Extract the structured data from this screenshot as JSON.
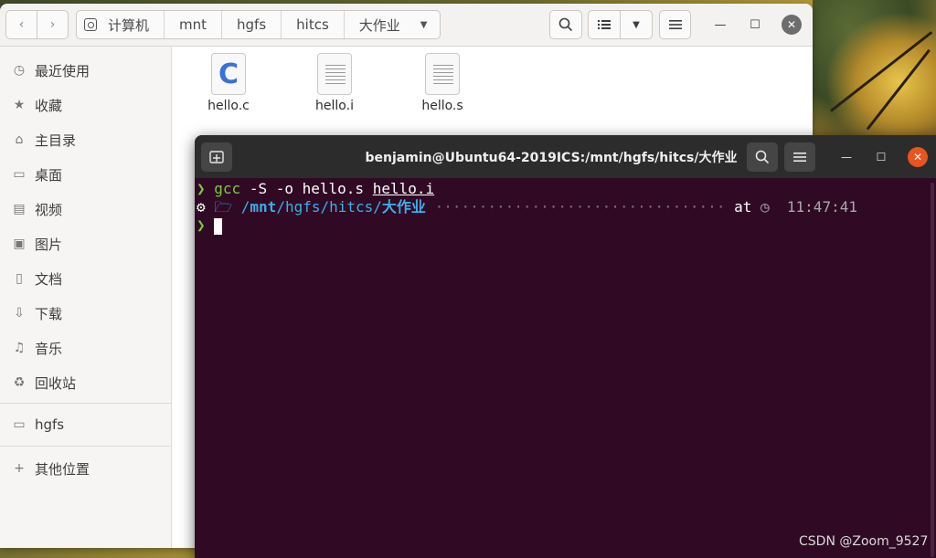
{
  "file_manager": {
    "nav": {
      "back_icon": "‹",
      "forward_icon": "›"
    },
    "path": [
      "计算机",
      "mnt",
      "hgfs",
      "hitcs",
      "大作业"
    ],
    "sidebar": [
      {
        "label": "最近使用",
        "icon": "clock-icon"
      },
      {
        "label": "收藏",
        "icon": "star-icon"
      },
      {
        "label": "主目录",
        "icon": "home-icon"
      },
      {
        "label": "桌面",
        "icon": "desktop-icon"
      },
      {
        "label": "视频",
        "icon": "video-icon"
      },
      {
        "label": "图片",
        "icon": "picture-icon"
      },
      {
        "label": "文档",
        "icon": "document-icon"
      },
      {
        "label": "下载",
        "icon": "download-icon"
      },
      {
        "label": "音乐",
        "icon": "music-icon"
      },
      {
        "label": "回收站",
        "icon": "trash-icon"
      },
      {
        "label": "hgfs",
        "icon": "folder-icon"
      },
      {
        "label": "其他位置",
        "icon": "plus-icon"
      }
    ],
    "files": [
      {
        "name": "hello.c",
        "type": "c-source",
        "glyph": "C"
      },
      {
        "name": "hello.i",
        "type": "text"
      },
      {
        "name": "hello.s",
        "type": "text"
      }
    ]
  },
  "terminal": {
    "title": "benjamin@Ubuntu64-2019ICS:/mnt/hgfs/hitcs/大作业",
    "prompt_symbol": "❯",
    "command": {
      "cmd": "gcc",
      "args": "-S -o hello.s",
      "file": "hello.i"
    },
    "path_line": {
      "os_icon": "ubuntu-icon",
      "path_prefix": "/",
      "path_mnt": "mnt",
      "path_rest": "/hgfs/hitcs/",
      "path_current": "大作业",
      "dots": "·································",
      "at": "at",
      "time": "11:47:41"
    }
  },
  "watermark": "CSDN @Zoom_9527"
}
